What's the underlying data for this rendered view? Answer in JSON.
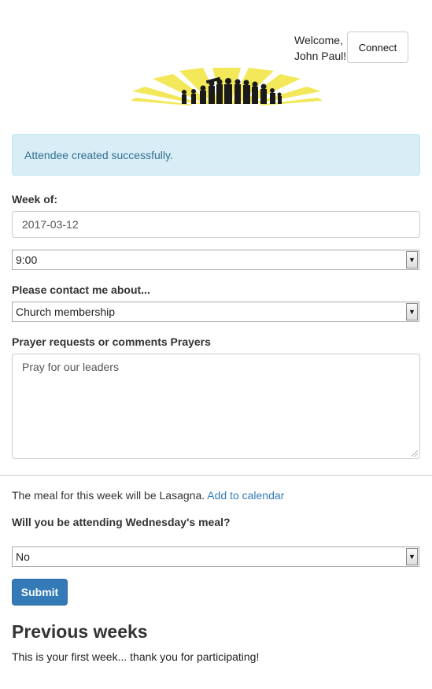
{
  "header": {
    "welcome_line1": "Welcome,",
    "welcome_line2": "John Paul!",
    "connect_label": "Connect"
  },
  "alert": {
    "message": "Attendee created successfully."
  },
  "form": {
    "week_label": "Week of:",
    "week_value": "2017-03-12",
    "time_selected": "9:00",
    "contact_label": "Please contact me about...",
    "contact_selected": "Church membership",
    "prayer_label": "Prayer requests or comments Prayers",
    "prayer_value": "Pray for our leaders"
  },
  "meal": {
    "text": "The meal for this week will be Lasagna.",
    "calendar_link": "Add to calendar",
    "question": "Will you be attending Wednesday's meal?",
    "attend_selected": "No"
  },
  "submit_label": "Submit",
  "previous": {
    "heading": "Previous weeks",
    "text": "This is your first week... thank you for participating!"
  },
  "colors": {
    "primary": "#337ab7",
    "alert_bg": "#d9edf7",
    "alert_text": "#31708f",
    "logo_rays": "#f2e85a"
  }
}
